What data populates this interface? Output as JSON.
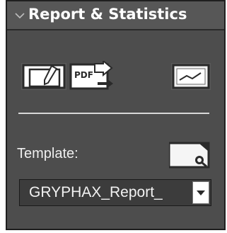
{
  "panel": {
    "title": "Report & Statistics",
    "collapse_icon": "chevron-down-icon"
  },
  "toolbar": {
    "edit_report_icon": "edit-document-icon",
    "export_pdf_icon": "pdf-export-icon",
    "pdf_text": "PDF",
    "statistics_icon": "line-chart-icon"
  },
  "template": {
    "label": "Template:",
    "preview_icon": "document-search-icon",
    "selected_value": "GRYPHAX_Report_",
    "dropdown_icon": "dropdown-arrow-icon"
  }
}
